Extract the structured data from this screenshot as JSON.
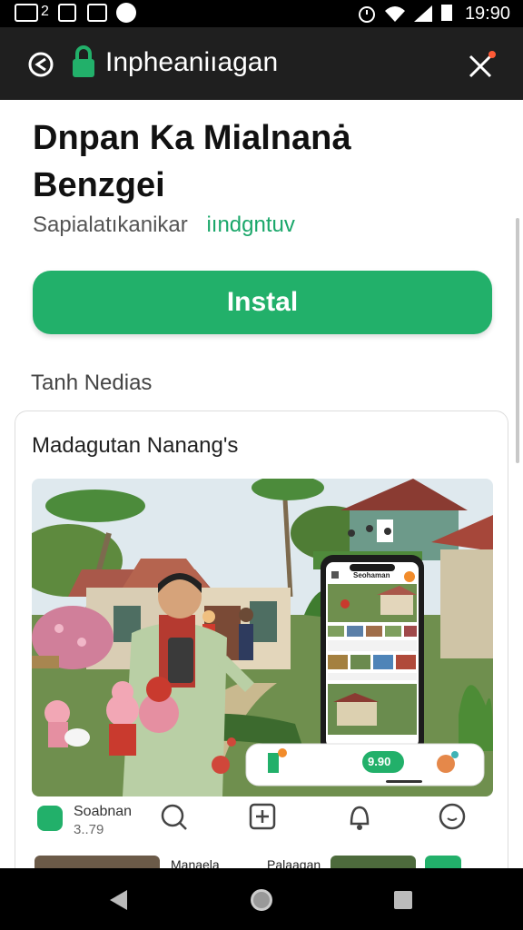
{
  "status_bar": {
    "time": "19:90",
    "left_badge": "2"
  },
  "app_bar": {
    "title": "Inpheaniıagan"
  },
  "app": {
    "title": "Dnpan Ka Mialnanȧ Benzgei",
    "developer": "Sapialatıkanikar",
    "tag": "iındgntuv",
    "install_label": "Instal"
  },
  "section": {
    "heading": "Tanh Nedias"
  },
  "card": {
    "title": "Madagutan Nanang's",
    "phone_header": "Seohaman",
    "phone_chip": "9.90"
  },
  "bottom_nav": {
    "items": [
      {
        "label": "Soabnan",
        "count": "3..79",
        "icon": "app-logo-icon"
      },
      {
        "label": "",
        "icon": "search-icon"
      },
      {
        "label": "",
        "icon": "add-box-icon"
      },
      {
        "label": "",
        "icon": "notification-icon"
      },
      {
        "label": "",
        "icon": "chat-icon"
      }
    ]
  },
  "peek": {
    "left_text": "Manaela",
    "right_text": "Palaaqan"
  },
  "colors": {
    "accent": "#22b06a",
    "appbar": "#1f1f1f",
    "status": "#000000"
  }
}
